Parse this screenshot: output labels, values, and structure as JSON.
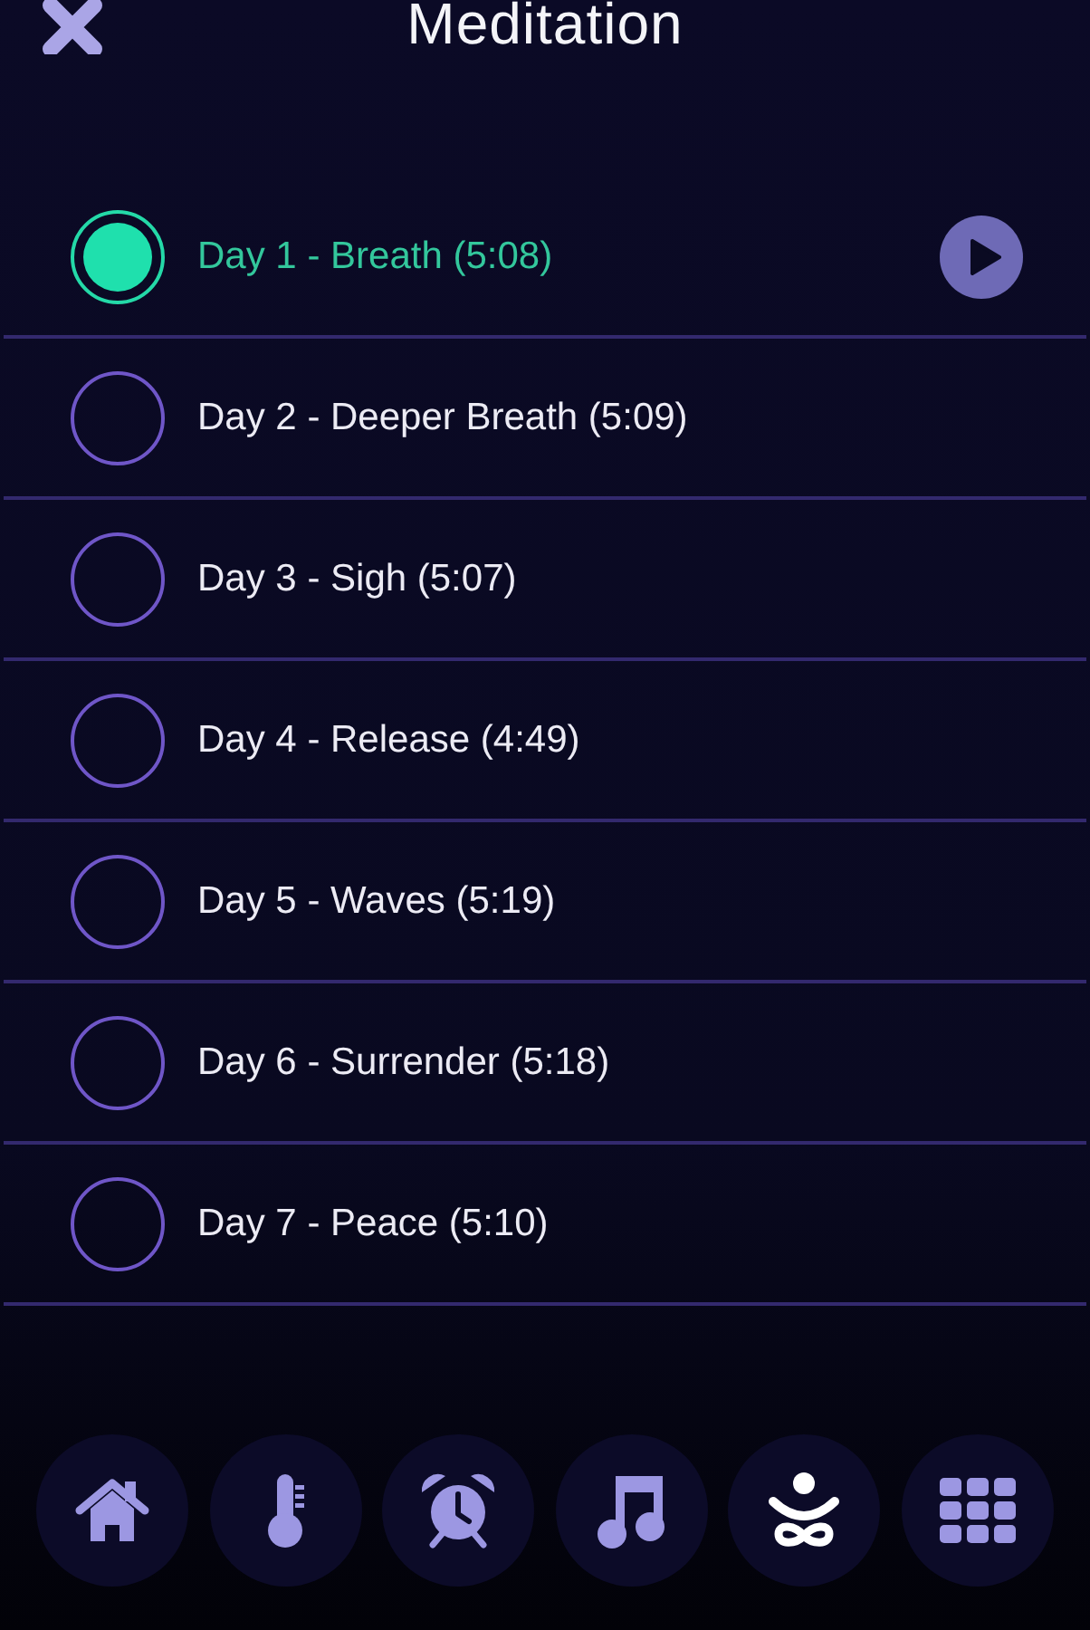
{
  "header": {
    "title": "Meditation"
  },
  "sessions": [
    {
      "label": "Day 1 - Breath (5:08)",
      "selected": true
    },
    {
      "label": "Day 2 - Deeper Breath (5:09)",
      "selected": false
    },
    {
      "label": "Day 3 - Sigh (5:07)",
      "selected": false
    },
    {
      "label": "Day 4 - Release (4:49)",
      "selected": false
    },
    {
      "label": "Day 5 - Waves (5:19)",
      "selected": false
    },
    {
      "label": "Day 6 - Surrender (5:18)",
      "selected": false
    },
    {
      "label": "Day 7 - Peace (5:10)",
      "selected": false
    }
  ],
  "nav": [
    {
      "kind": "home",
      "selected": false
    },
    {
      "kind": "temperature",
      "selected": false
    },
    {
      "kind": "alarm",
      "selected": false
    },
    {
      "kind": "music",
      "selected": false
    },
    {
      "kind": "meditation",
      "selected": true
    },
    {
      "kind": "apps",
      "selected": false
    }
  ]
}
